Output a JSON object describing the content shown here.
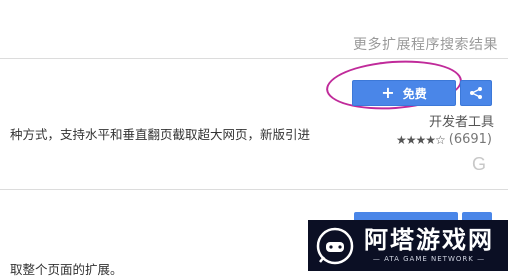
{
  "header": {
    "more_results": "更多扩展程序搜索结果"
  },
  "item1": {
    "button_label": "免费",
    "description": "种方式，支持水平和垂直翻页截取超大网页，新版引进",
    "category": "开发者工具",
    "rating_count": "(6691)",
    "stars": "★★★★☆",
    "g_glyph": "G"
  },
  "item2": {
    "description": "取整个页面的扩展。"
  },
  "watermark": {
    "title": "阿塔游戏网",
    "subtitle": "— ATA GAME NETWORK —"
  },
  "colors": {
    "accent": "#4a86e8",
    "annotation": "#c02a9a"
  }
}
